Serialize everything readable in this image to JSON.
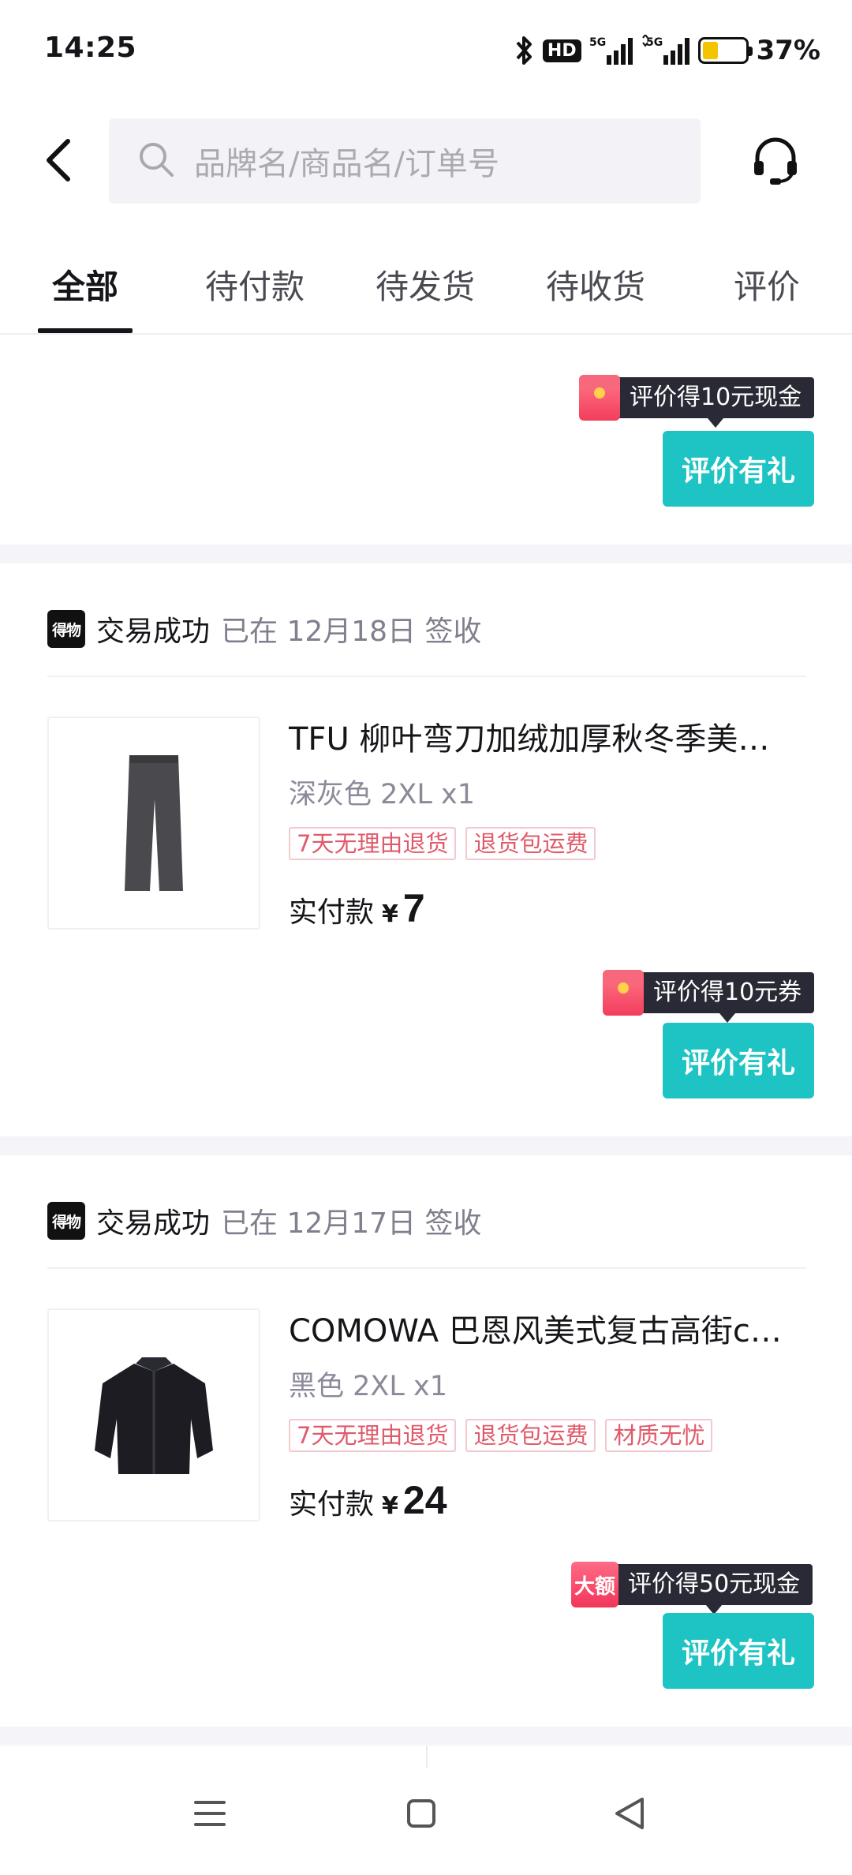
{
  "status_bar": {
    "time": "14:25",
    "hd_label": "HD",
    "battery_percent": "37%",
    "battery_level": 0.37
  },
  "header": {
    "search_placeholder": "品牌名/商品名/订单号"
  },
  "tabs": [
    {
      "label": "全部",
      "active": true
    },
    {
      "label": "待付款",
      "active": false
    },
    {
      "label": "待发货",
      "active": false
    },
    {
      "label": "待收货",
      "active": false
    },
    {
      "label": "评价",
      "active": false
    }
  ],
  "orders": [
    {
      "reward_text": "评价得10元现金",
      "review_button": "评价有礼"
    },
    {
      "brand_logo": "得物",
      "status": "交易成功",
      "date_text": "已在 12月18日 签收",
      "title": "TFU 柳叶弯刀加绒加厚秋冬季美式复古直筒休闲长裤",
      "spec": "深灰色 2XL x1",
      "tags": [
        "7天无理由退货",
        "退货包运费"
      ],
      "paid_label": "实付款",
      "currency": "¥",
      "paid_value": "7",
      "reward_text": "评价得10元券",
      "review_button": "评价有礼"
    },
    {
      "brand_logo": "得物",
      "status": "交易成功",
      "date_text": "已在 12月17日 签收",
      "title": "COMOWA 巴恩风美式复古高街clean fit夹克外套",
      "spec": "黑色 2XL x1",
      "tags": [
        "7天无理由退货",
        "退货包运费",
        "材质无忧"
      ],
      "paid_label": "实付款",
      "currency": "¥",
      "paid_value": "24",
      "reward_badge": "大额",
      "reward_text": "评价得50元现金",
      "review_button": "评价有礼"
    }
  ],
  "colors": {
    "accent": "#1ec4c3",
    "tag_red": "#e05a6a",
    "tooltip_bg": "#2a2a36",
    "section_gap": "#f5f5f9"
  }
}
